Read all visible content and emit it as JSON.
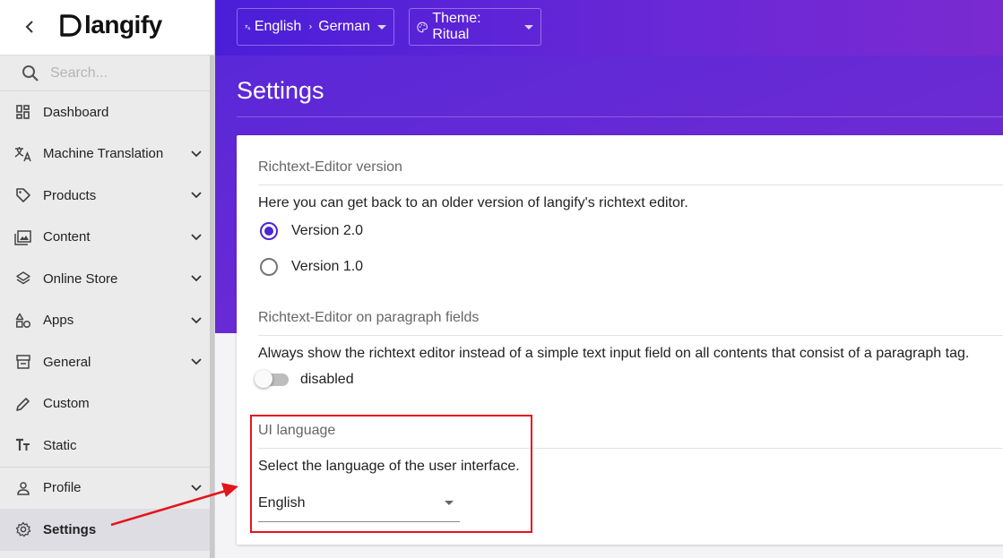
{
  "sidebar": {
    "brand": "langify",
    "search_placeholder": "Search...",
    "items": [
      {
        "label": "Dashboard",
        "icon": "dashboard-icon",
        "has_children": false
      },
      {
        "label": "Machine Translation",
        "icon": "translate-icon",
        "has_children": true
      },
      {
        "label": "Products",
        "icon": "tag-icon",
        "has_children": true
      },
      {
        "label": "Content",
        "icon": "image-gallery-icon",
        "has_children": true
      },
      {
        "label": "Online Store",
        "icon": "layers-icon",
        "has_children": true
      },
      {
        "label": "Apps",
        "icon": "apps-shapes-icon",
        "has_children": true
      },
      {
        "label": "General",
        "icon": "storefront-icon",
        "has_children": true
      },
      {
        "label": "Custom",
        "icon": "pencil-icon",
        "has_children": false
      },
      {
        "label": "Static",
        "icon": "text-format-icon",
        "has_children": false
      },
      {
        "label": "Profile",
        "icon": "person-icon",
        "has_children": true
      },
      {
        "label": "Settings",
        "icon": "gear-icon",
        "has_children": false,
        "active": true
      }
    ]
  },
  "topbar": {
    "language_from": "English",
    "language_to": "German",
    "theme_label": "Theme: Ritual"
  },
  "page": {
    "title": "Settings"
  },
  "settings": {
    "richtext_version": {
      "heading": "Richtext-Editor version",
      "description": "Here you can get back to an older version of langify's richtext editor.",
      "options": [
        {
          "label": "Version 2.0",
          "selected": true
        },
        {
          "label": "Version 1.0",
          "selected": false
        }
      ]
    },
    "richtext_paragraph": {
      "heading": "Richtext-Editor on paragraph fields",
      "description": "Always show the richtext editor instead of a simple text input field on all contents that consist of a paragraph tag.",
      "toggle_label": "disabled",
      "toggle_on": false
    },
    "ui_language": {
      "heading": "UI language",
      "description": "Select the language of the user interface.",
      "selected": "English"
    }
  },
  "colors": {
    "accent": "#4a25d6",
    "header_gradient_start": "#4a1ed8",
    "header_gradient_end": "#7a2ad0",
    "annotation": "#e4141b"
  }
}
